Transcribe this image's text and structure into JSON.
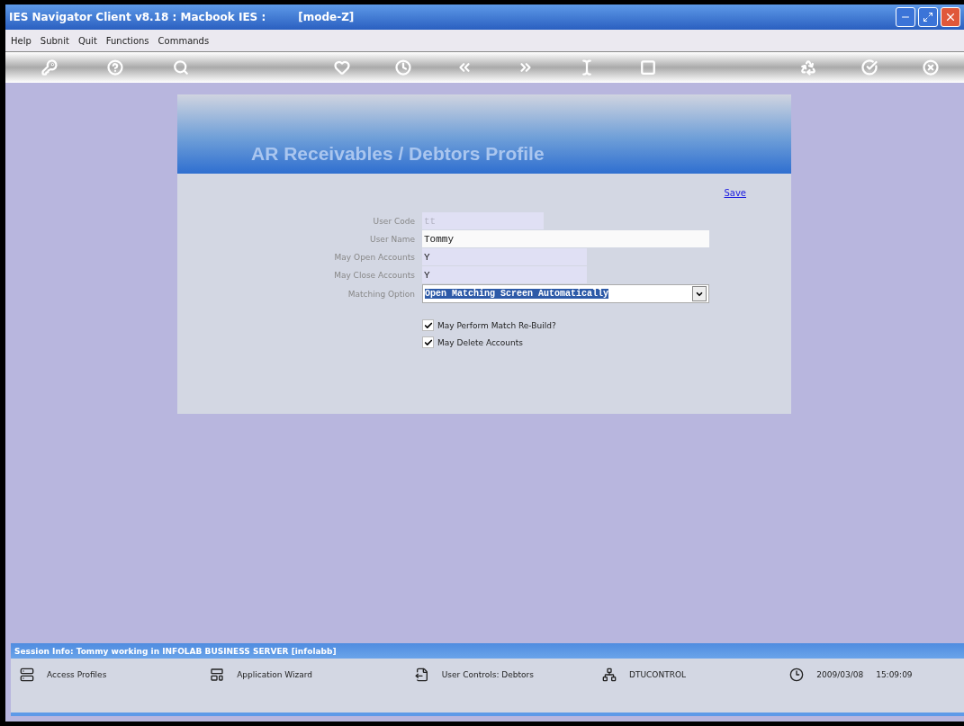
{
  "window": {
    "title": "IES Navigator Client v8.18 : Macbook IES :",
    "mode": "[mode-Z]"
  },
  "menu": [
    "Help",
    "Subnit",
    "Quit",
    "Functions",
    "Commands"
  ],
  "panel": {
    "title": "AR Receivables / Debtors Profile",
    "save_link": "Save",
    "fields": [
      {
        "kind": "text",
        "label": "User Code",
        "value": "tt",
        "disabled": true
      },
      {
        "kind": "text",
        "label": "User Name",
        "value": "Tommy"
      },
      {
        "kind": "text",
        "label": "May Open Accounts",
        "value": "Y"
      },
      {
        "kind": "text",
        "label": "May Close Accounts",
        "value": "Y"
      },
      {
        "kind": "select",
        "label": "Matching Option",
        "value": "Open Matching Screen Automatically"
      }
    ],
    "checkboxes": [
      {
        "label": "May Perform Match Re-Build?",
        "checked": true
      },
      {
        "label": "May Delete Accounts",
        "checked": true
      }
    ]
  },
  "session_info": "Session Info: Tommy working in INFOLAB BUSINESS SERVER  [infolabb]",
  "status_bar": {
    "items": [
      "Access Profiles",
      "Application Wizard",
      "User Controls: Debtors",
      "DTUCONTROL"
    ],
    "date": "2009/03/08",
    "time": "15:09:09"
  }
}
